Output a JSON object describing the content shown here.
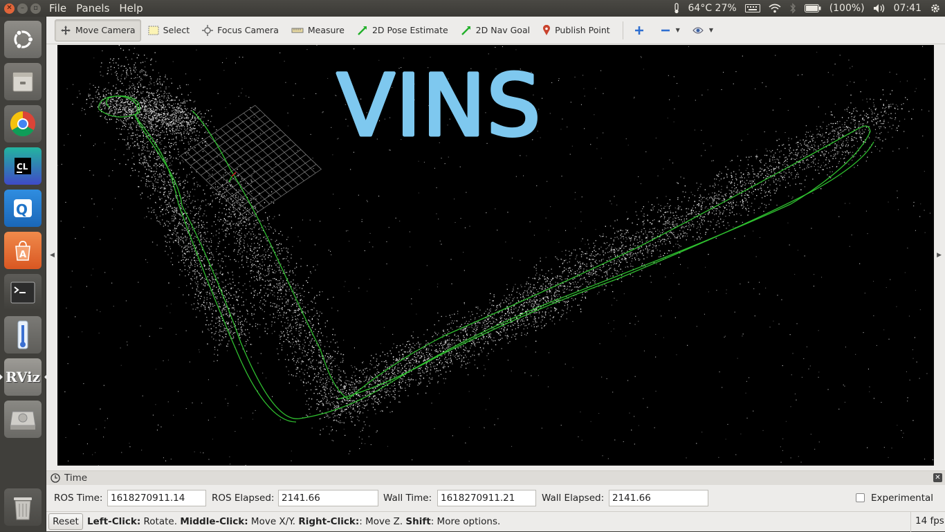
{
  "menu": {
    "file": "File",
    "panels": "Panels",
    "help": "Help"
  },
  "tray": {
    "temp": "64°C 27%",
    "battery": "(100%)",
    "clock": "07:41"
  },
  "launcher": {
    "items": [
      "ubuntu-dash",
      "files",
      "chrome",
      "clion",
      "qq",
      "software-center",
      "terminal",
      "thermometer",
      "rviz",
      "disk",
      "trash"
    ],
    "rviz_label": "RViz"
  },
  "toolbar": {
    "move_camera": "Move Camera",
    "select": "Select",
    "focus_camera": "Focus Camera",
    "measure": "Measure",
    "pose_estimate": "2D Pose Estimate",
    "nav_goal": "2D Nav Goal",
    "publish_point": "Publish Point"
  },
  "viewport": {
    "overlay_text": "VINS",
    "overlay_color": "#7ec8ef",
    "path_color": "#2fbf2f"
  },
  "time": {
    "title": "Time",
    "ros_time_label": "ROS Time:",
    "ros_time": "1618270911.14",
    "ros_elapsed_label": "ROS Elapsed:",
    "ros_elapsed": "2141.66",
    "wall_time_label": "Wall Time:",
    "wall_time": "1618270911.21",
    "wall_elapsed_label": "Wall Elapsed:",
    "wall_elapsed": "2141.66",
    "experimental": "Experimental"
  },
  "status": {
    "reset": "Reset",
    "left_click": "Left-Click:",
    "left_click_action": " Rotate. ",
    "middle_click": "Middle-Click:",
    "middle_click_action": " Move X/Y. ",
    "right_click": "Right-Click:",
    "right_click_action": ": Move Z. ",
    "shift": "Shift",
    "shift_action": ": More options.",
    "fps": "14 fps"
  }
}
